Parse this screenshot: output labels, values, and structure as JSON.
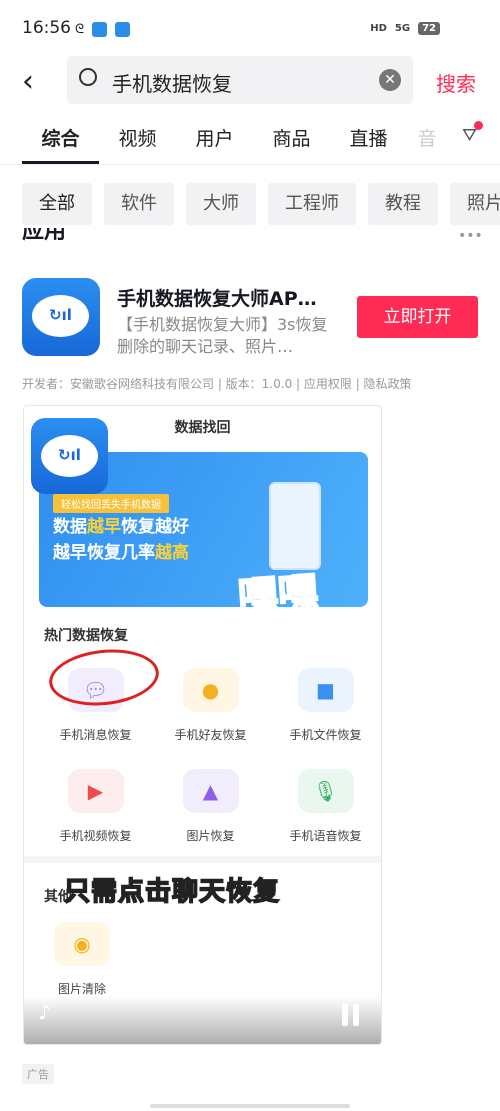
{
  "status_bar": {
    "time": "16:56",
    "network": "5G",
    "hd": "HD",
    "battery": "72"
  },
  "search": {
    "query": "手机数据恢复",
    "button": "搜索"
  },
  "tabs": [
    "综合",
    "视频",
    "用户",
    "商品",
    "直播",
    "音"
  ],
  "chips": [
    "全部",
    "软件",
    "大师",
    "工程师",
    "教程",
    "照片"
  ],
  "section_title": "应用",
  "app": {
    "name": "手机数据恢复大师AP…",
    "desc": "【手机数据恢复大师】3s恢复删除的聊天记录、照片…",
    "open_button": "立即打开",
    "dev_info": "开发者：安徽歌谷网络科技有限公司 | 版本：1.0.0 | 应用权限 | 隐私政策"
  },
  "video": {
    "title": "数据找回",
    "banner_tag": "轻松找回丢失手机数据",
    "banner_line1a": "数据",
    "banner_line1b": "越早",
    "banner_line1c": "恢复越好",
    "banner_line2a": "越早恢复几率",
    "banner_line2b": "越高",
    "sticker": "嘿嘿",
    "hot_title": "热门数据恢复",
    "items": [
      {
        "label": "手机消息恢复",
        "icon": "chat-icon",
        "color": "#9b7be8",
        "bg": "#f1edfc"
      },
      {
        "label": "手机好友恢复",
        "icon": "user-icon",
        "color": "#f5b01e",
        "bg": "#fff6e3"
      },
      {
        "label": "手机文件恢复",
        "icon": "folder-icon",
        "color": "#3b8ff0",
        "bg": "#eaf3fe"
      },
      {
        "label": "手机视频恢复",
        "icon": "video-icon",
        "color": "#f04c4c",
        "bg": "#fdeded"
      },
      {
        "label": "图片恢复",
        "icon": "image-icon",
        "color": "#8e5ee8",
        "bg": "#f1edfc"
      },
      {
        "label": "手机语音恢复",
        "icon": "mic-icon",
        "color": "#36b46a",
        "bg": "#e9f7ee"
      }
    ],
    "other_title": "其他",
    "caption": "只需点击聊天恢复",
    "other_item": {
      "label": "图片清除",
      "icon": "picture-icon"
    }
  },
  "ad_label": "广告",
  "colors": {
    "accent": "#fe2c55",
    "app_blue": "#1768d8"
  }
}
